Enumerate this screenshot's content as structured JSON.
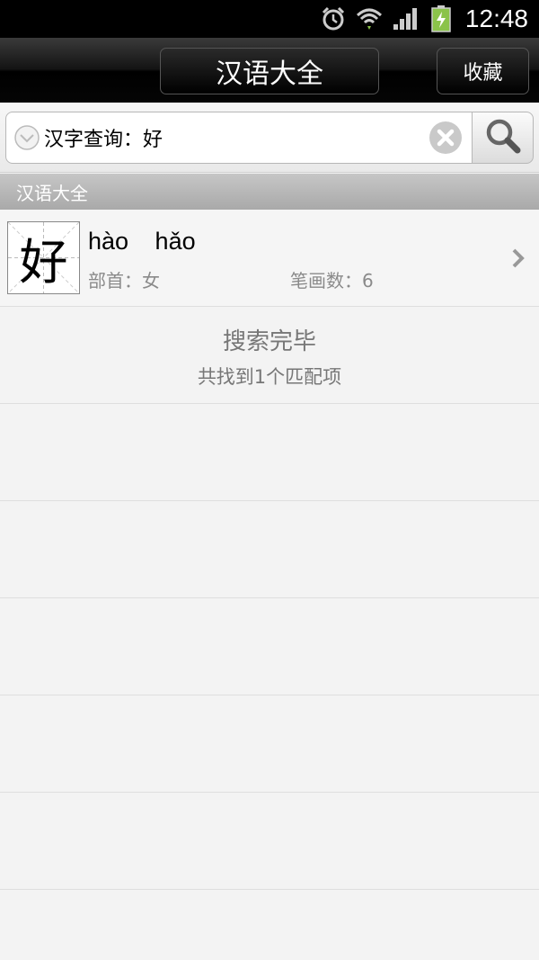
{
  "status_bar": {
    "time": "12:48",
    "icons": [
      "alarm-icon",
      "wifi-icon",
      "signal-icon",
      "battery-charging-icon"
    ]
  },
  "header": {
    "title": "汉语大全",
    "favorites_label": "收藏"
  },
  "search": {
    "value": "汉字查询：好",
    "icons": [
      "dropdown-icon",
      "clear-icon",
      "search-icon"
    ]
  },
  "section": {
    "title": "汉语大全"
  },
  "result": {
    "character": "好",
    "pinyin": "hào hǎo",
    "radical": "部首：女",
    "strokes": "笔画数：6"
  },
  "summary": {
    "title": "搜索完毕",
    "count": "共找到1个匹配项"
  },
  "colors": {
    "title_bar": "#000000",
    "section_header": "#b5b5b5",
    "battery": "#8bc34a",
    "background": "#f3f3f3"
  }
}
